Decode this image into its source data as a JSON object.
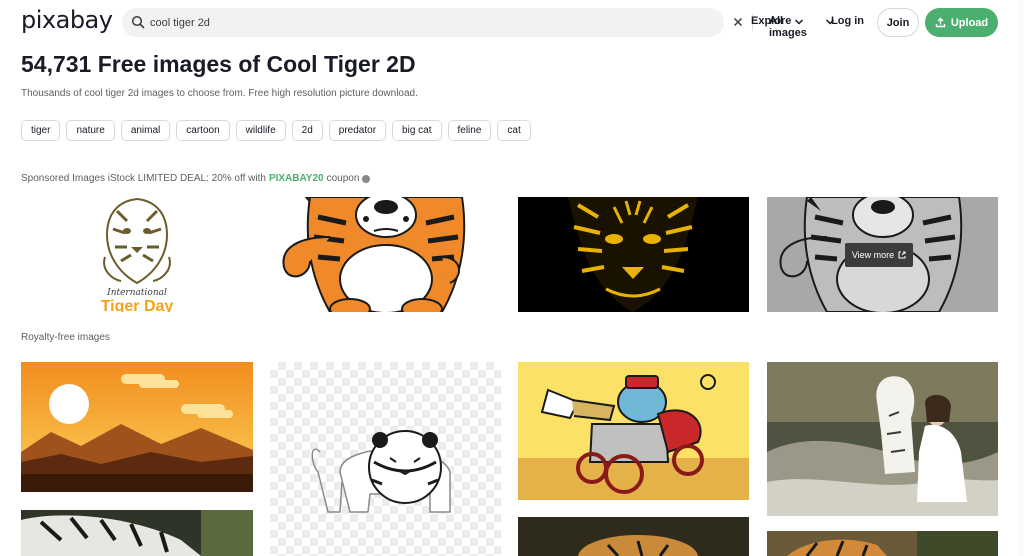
{
  "header": {
    "logo": "pixabay",
    "search_value": "cool tiger 2d",
    "search_type": "All images",
    "nav_explore": "Explore",
    "nav_login": "Log in",
    "join_label": "Join",
    "upload_label": "Upload"
  },
  "page": {
    "title": "54,731 Free images of Cool Tiger 2D",
    "subtitle": "Thousands of cool tiger 2d images to choose from. Free high resolution picture download."
  },
  "tags": [
    "tiger",
    "nature",
    "animal",
    "cartoon",
    "wildlife",
    "2d",
    "predator",
    "big cat",
    "feline",
    "cat"
  ],
  "sponsored": {
    "text": "Sponsored Images iStock LIMITED DEAL: 20% off with",
    "code": "PIXABAY20",
    "suffix": "coupon",
    "view_more": "View more",
    "images": [
      {
        "caption_line1": "International",
        "caption_line2": "Tiger Day"
      }
    ]
  },
  "royalty_free_label": "Royalty-free images",
  "colors": {
    "brand_green": "#4baf6f",
    "text_dark": "#191b26",
    "text_muted": "#5f5f5f"
  }
}
